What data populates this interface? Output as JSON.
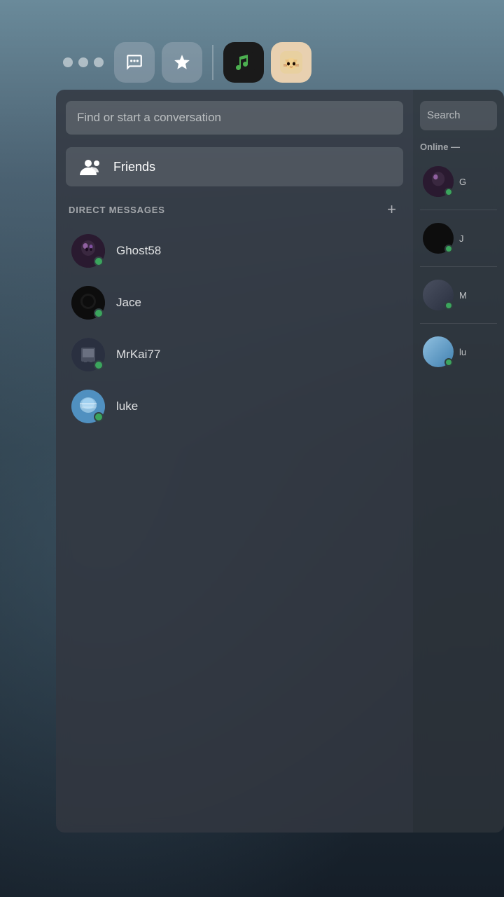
{
  "topBar": {
    "dots": [
      "dot1",
      "dot2",
      "dot3"
    ],
    "chatIcon": "💬",
    "starIcon": "⭐",
    "musicAppLabel": "music-app",
    "catAppLabel": "cat-app"
  },
  "searchBar": {
    "placeholder": "Find or start a conversation"
  },
  "friendsButton": {
    "label": "Friends"
  },
  "directMessages": {
    "sectionTitle": "DIRECT MESSAGES",
    "addLabel": "+",
    "users": [
      {
        "name": "Ghost58",
        "status": "online",
        "avatarClass": "avatar-ghost58"
      },
      {
        "name": "Jace",
        "status": "online",
        "avatarClass": "avatar-jace"
      },
      {
        "name": "MrKai77",
        "status": "online",
        "avatarClass": "avatar-mrkai77"
      },
      {
        "name": "luke",
        "status": "online",
        "avatarClass": "avatar-luke"
      }
    ]
  },
  "rightPanel": {
    "searchPlaceholder": "Search",
    "onlineLabel": "Online —",
    "users": [
      {
        "name": "G",
        "avatarClass": "avatar-ghost58"
      },
      {
        "name": "J",
        "avatarClass": "avatar-jace"
      },
      {
        "name": "M",
        "avatarClass": "avatar-mrkai77"
      },
      {
        "name": "lu",
        "avatarClass": "avatar-luke"
      }
    ]
  }
}
